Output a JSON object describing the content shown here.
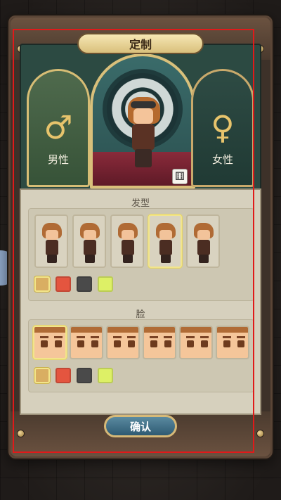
{
  "header": {
    "title": "定制"
  },
  "gender": {
    "male": {
      "symbol": "♂",
      "label": "男性",
      "icon": "male-symbol-icon"
    },
    "female": {
      "symbol": "♀",
      "label": "女性",
      "icon": "female-symbol-icon"
    }
  },
  "preview": {
    "dice_icon": "dice-icon",
    "dice_glyph": "⚅"
  },
  "hair": {
    "title": "发型",
    "selected_index": 3,
    "colors": [
      "#d9ae62",
      "#e4553f",
      "#4a4a4a",
      "#ddf066"
    ],
    "selected_color": 0
  },
  "face": {
    "title": "脸",
    "selected_index": 0,
    "colors": [
      "#d9ae62",
      "#e4553f",
      "#4a4a4a",
      "#ddf066"
    ],
    "selected_color": 0
  },
  "footer": {
    "confirm_label": "确认"
  },
  "nav": {
    "arrow_glyph": "›",
    "arrow_icon": "chevron-right-icon"
  }
}
